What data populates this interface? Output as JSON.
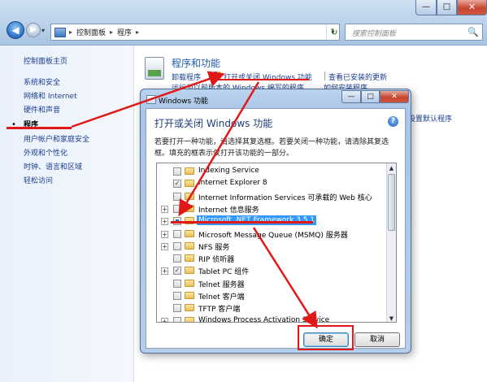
{
  "window": {
    "min_glyph": "—",
    "max_glyph": "□",
    "close_glyph": "✕"
  },
  "nav": {
    "back_glyph": "◀",
    "forward_glyph": "▶",
    "dropdown_glyph": "▾"
  },
  "address": {
    "crumbs": [
      "控制面板",
      "程序"
    ],
    "sep": "▸",
    "dropdown": "▾",
    "refresh_glyph": "↻"
  },
  "search": {
    "placeholder": "搜索控制面板",
    "icon": "🔍"
  },
  "leftnav": {
    "home": "控制面板主页",
    "items": [
      "系统和安全",
      "网络和 Internet",
      "硬件和声音",
      "程序",
      "用户帐户和家庭安全",
      "外观和个性化",
      "时钟、语言和区域",
      "轻松访问"
    ],
    "active_index": 3,
    "bullet": "•"
  },
  "main": {
    "title": "程序和功能",
    "links": [
      "卸载程序",
      "打开或关闭 Windows 功能",
      "查看已安装的更新"
    ],
    "obscured_links": [
      "运行为以前版本的 Windows 编写的程序",
      "如何安装程序"
    ],
    "right_link": "设置默认程序"
  },
  "dialog": {
    "title": "Windows 功能",
    "heading": "打开或关闭 Windows 功能",
    "description": "若要打开一种功能，请选择其复选框。若要关闭一种功能，请清除其复选框。填充的框表示仅打开该功能的一部分。",
    "help_glyph": "?",
    "min_glyph": "—",
    "max_glyph": "□",
    "close_glyph": "✕",
    "features": [
      {
        "label": "Indexing Service",
        "expandable": false,
        "state": "unchecked"
      },
      {
        "label": "Internet Explorer 8",
        "expandable": false,
        "state": "checked"
      },
      {
        "label": "Internet Information Services 可承载的 Web 核心",
        "expandable": false,
        "state": "unchecked"
      },
      {
        "label": "Internet 信息服务",
        "expandable": true,
        "state": "unchecked"
      },
      {
        "label": "Microsoft .NET Framework 3.5.1",
        "expandable": true,
        "state": "partial",
        "selected": true
      },
      {
        "label": "Microsoft Message Queue (MSMQ) 服务器",
        "expandable": true,
        "state": "unchecked"
      },
      {
        "label": "NFS 服务",
        "expandable": true,
        "state": "unchecked"
      },
      {
        "label": "RIP 侦听器",
        "expandable": false,
        "state": "unchecked"
      },
      {
        "label": "Tablet PC 组件",
        "expandable": true,
        "state": "checked"
      },
      {
        "label": "Telnet 服务器",
        "expandable": false,
        "state": "unchecked"
      },
      {
        "label": "Telnet 客户端",
        "expandable": false,
        "state": "unchecked"
      },
      {
        "label": "TFTP 客户端",
        "expandable": false,
        "state": "unchecked"
      },
      {
        "label": "Windows Process Activation Service",
        "expandable": true,
        "state": "unchecked"
      }
    ],
    "expand_glyph": "+",
    "check_glyph": "✓",
    "scroll_up": "▲",
    "scroll_down": "▼",
    "ok_label": "确定",
    "cancel_label": "取消"
  },
  "colors": {
    "annotation_red": "#e01818",
    "link_blue": "#1a3e8c",
    "selection_blue": "#3399ff"
  }
}
